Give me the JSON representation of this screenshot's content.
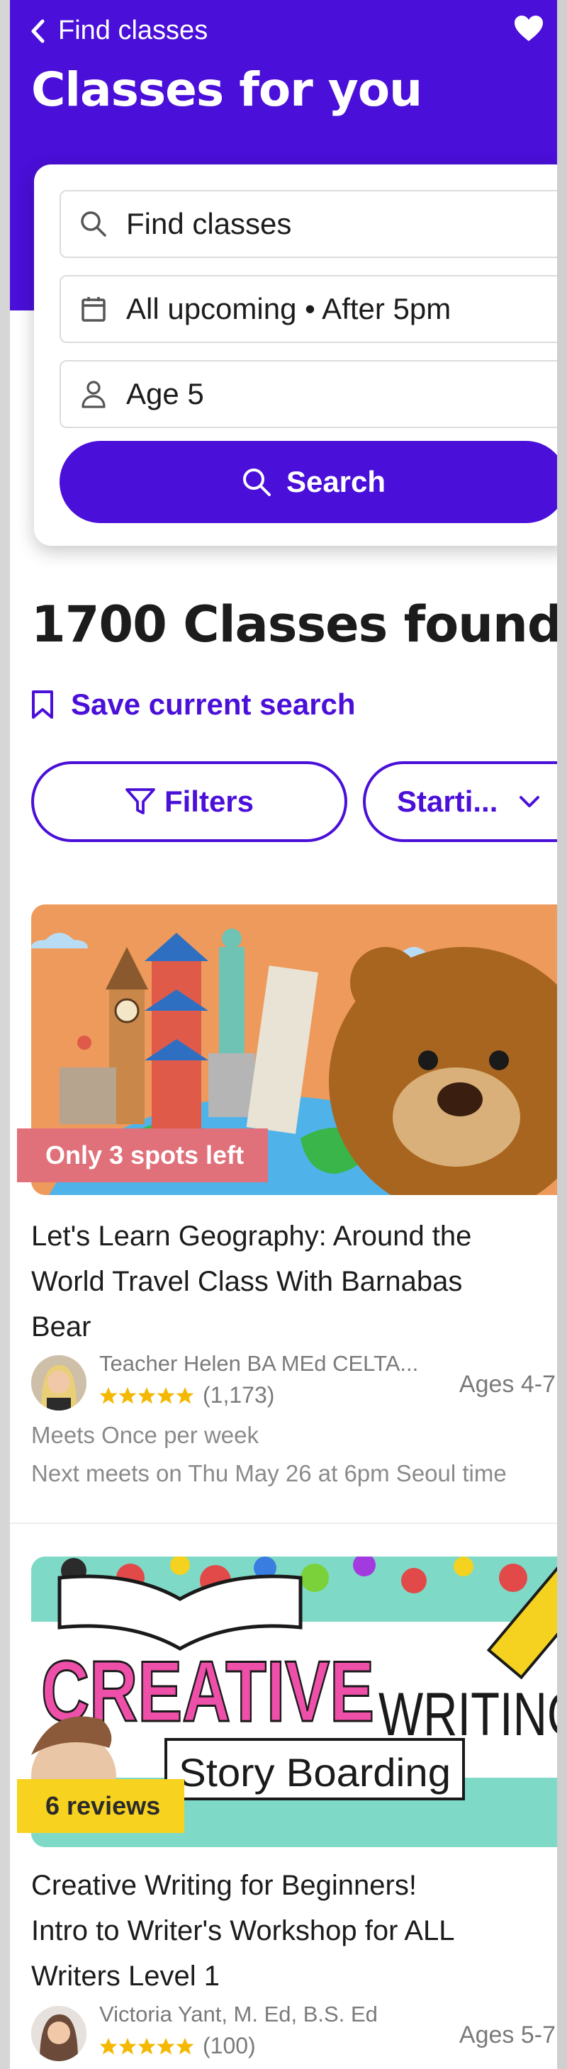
{
  "header": {
    "back_label": "Find classes",
    "title": "Classes for you"
  },
  "search": {
    "query": "Find classes",
    "schedule": "All upcoming • After 5pm",
    "age": "Age 5",
    "button_label": "Search"
  },
  "results": {
    "count_title": "1700 Classes found",
    "save_label": "Save current search",
    "filters_label": "Filters",
    "sort_label": "Starti..."
  },
  "classes": [
    {
      "badge": "Only 3 spots left",
      "title_lines": [
        "Let's Learn Geography: Around the",
        "World Travel Class With Barnabas",
        "Bear"
      ],
      "teacher": "Teacher Helen BA MEd CELTA...",
      "rating_count": "(1,173)",
      "ages": "Ages 4-7",
      "meets": "Meets Once per week",
      "next": "Next meets on Thu May 26 at 6pm Seoul time"
    },
    {
      "badge": "6 reviews",
      "image_text_1": "CREATIVE",
      "image_text_2": "WRITING",
      "image_text_3": "Story Boarding",
      "title_lines": [
        "Creative Writing for Beginners!",
        "Intro to Writer's Workshop for ALL",
        "Writers Level 1"
      ],
      "teacher": "Victoria Yant, M. Ed, B.S. Ed",
      "rating_count": "(100)",
      "ages": "Ages 5-7"
    }
  ],
  "colors": {
    "brand": "#4a0fd8",
    "star": "#f5b800",
    "badge_red": "#e0707a",
    "badge_yellow": "#f7d21f"
  },
  "icons": {
    "back": "chevron-left-icon",
    "favorite": "heart-icon",
    "search": "search-icon",
    "calendar": "calendar-icon",
    "person": "person-icon",
    "bookmark": "bookmark-icon",
    "filter": "filter-icon",
    "dropdown": "chevron-down-icon",
    "star": "star-icon"
  }
}
